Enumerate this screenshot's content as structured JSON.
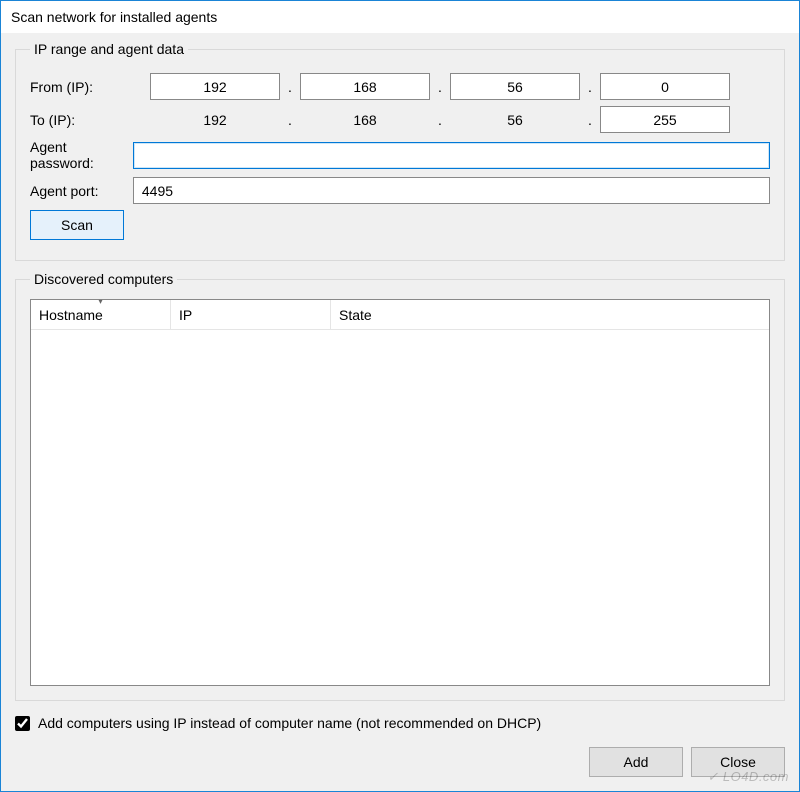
{
  "title": "Scan network for installed agents",
  "group_ip": {
    "legend": "IP range and agent data",
    "from_label": "From (IP):",
    "to_label": "To (IP):",
    "octets_from": [
      "192",
      "168",
      "56",
      "0"
    ],
    "octets_to_static": [
      "192",
      "168",
      "56"
    ],
    "octet_to_last": "255",
    "password_label": "Agent password:",
    "password_value": "",
    "port_label": "Agent port:",
    "port_value": "4495",
    "scan_label": "Scan",
    "dot": "."
  },
  "group_discovered": {
    "legend": "Discovered computers",
    "columns": {
      "hostname": "Hostname",
      "ip": "IP",
      "state": "State"
    }
  },
  "checkbox": {
    "label": "Add computers using IP instead of computer name (not recommended on DHCP)"
  },
  "buttons": {
    "add": "Add",
    "close": "Close"
  },
  "watermark": "✓ LO4D.com"
}
